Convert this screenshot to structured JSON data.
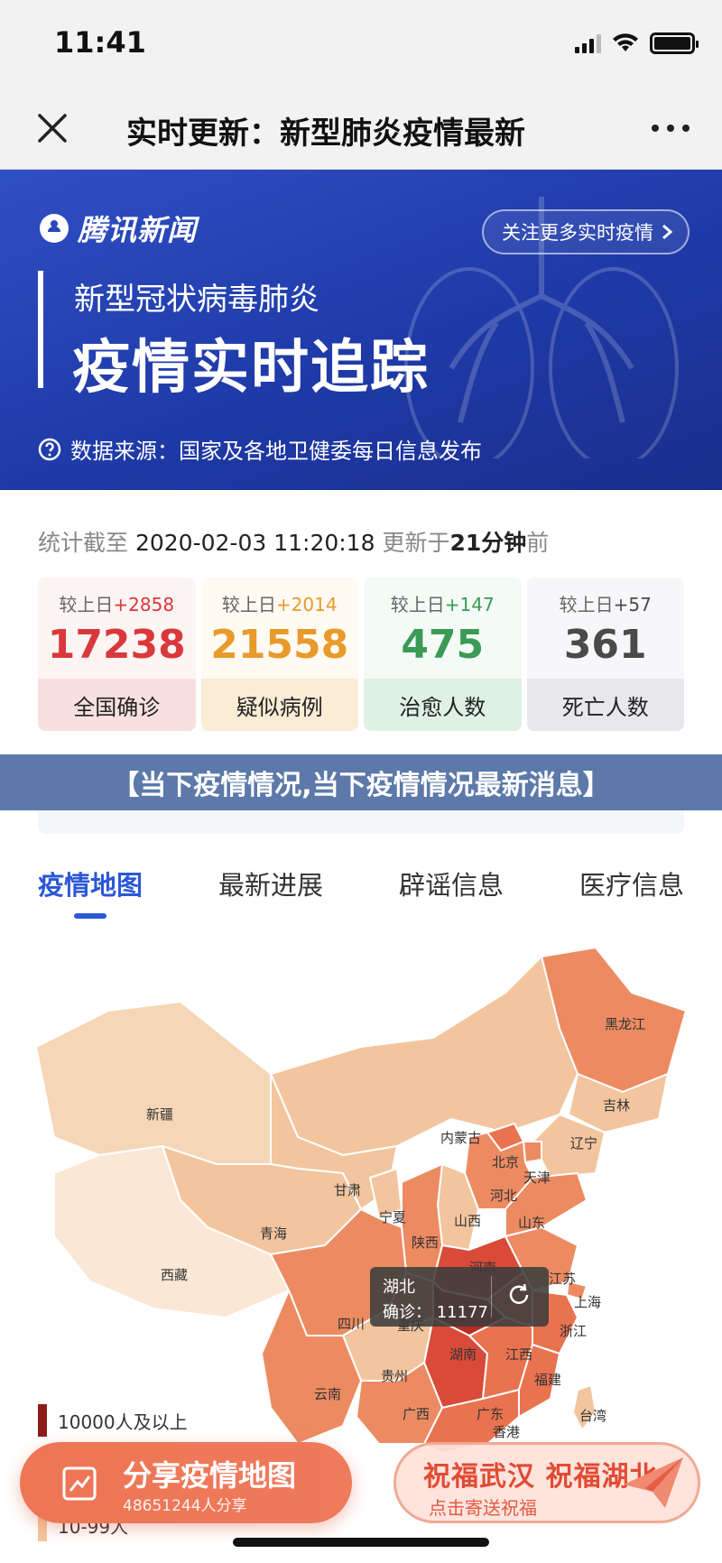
{
  "status_bar": {
    "time": "11:41"
  },
  "nav": {
    "title": "实时更新：新型肺炎疫情最新"
  },
  "hero": {
    "logo": "腾讯新闻",
    "follow_label": "关注更多实时疫情",
    "subtitle": "新型冠状病毒肺炎",
    "title": "疫情实时追踪",
    "source": "数据来源：国家及各地卫健委每日信息发布"
  },
  "stats": {
    "caption_prefix": "统计截至",
    "timestamp": "2020-02-03 11:20:18",
    "updated_prefix": "更新于",
    "updated_ago": "21分钟",
    "updated_suffix": "前",
    "cards": [
      {
        "delta_label": "较上日",
        "delta": "+2858",
        "value": "17238",
        "label": "全国确诊",
        "color": "#d9393c",
        "bg_top": "#fdf4f4",
        "bg_label": "#f9e0e0"
      },
      {
        "delta_label": "较上日",
        "delta": "+2014",
        "value": "21558",
        "label": "疑似病例",
        "color": "#e89a2a",
        "bg_top": "#fffaf2",
        "bg_label": "#fbecd6"
      },
      {
        "delta_label": "较上日",
        "delta": "+147",
        "value": "475",
        "label": "治愈人数",
        "color": "#3b9a55",
        "bg_top": "#f4fbf6",
        "bg_label": "#dff1e4"
      },
      {
        "delta_label": "较上日",
        "delta": "+57",
        "value": "361",
        "label": "死亡人数",
        "color": "#4a4a4a",
        "bg_top": "#f7f7f9",
        "bg_label": "#e8e8ec"
      }
    ]
  },
  "headline": "【当下疫情情况,当下疫情情况最新消息】",
  "tabs": [
    {
      "label": "疫情地图",
      "active": true
    },
    {
      "label": "最新进展",
      "active": false
    },
    {
      "label": "辟谣信息",
      "active": false
    },
    {
      "label": "医疗信息",
      "active": false
    }
  ],
  "map": {
    "provinces": [
      "黑龙江",
      "吉林",
      "辽宁",
      "内蒙古",
      "北京",
      "天津",
      "河北",
      "山西",
      "山东",
      "新疆",
      "甘肃",
      "宁夏",
      "陕西",
      "青海",
      "西藏",
      "河南",
      "江苏",
      "上海",
      "四川",
      "重庆",
      "湖北",
      "浙江",
      "湖南",
      "江西",
      "贵州",
      "云南",
      "福建",
      "广西",
      "广东",
      "台湾",
      "香港"
    ],
    "tooltip": {
      "province": "湖北",
      "label": "确诊：",
      "value": "11177"
    },
    "legend": [
      {
        "label": "10000人及以上",
        "color": "#8c1d18"
      },
      {
        "label": "10-99人",
        "color": "#f2c59f"
      }
    ]
  },
  "share": {
    "title": "分享疫情地图",
    "count": "48651244人分享"
  },
  "bless": {
    "title": "祝福武汉 祝福湖北",
    "subtitle": "点击寄送祝福"
  }
}
